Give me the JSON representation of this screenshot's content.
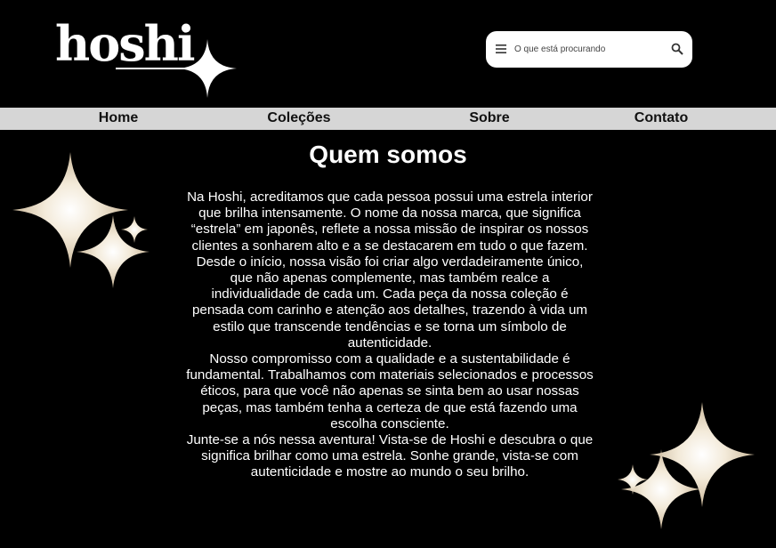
{
  "brand": {
    "name": "hoshi",
    "icon": "sparkle-star-icon"
  },
  "search": {
    "placeholder": "O que está procurando",
    "menu_icon": "menu-icon",
    "search_icon": "search-icon"
  },
  "nav": {
    "items": [
      {
        "label": "Home"
      },
      {
        "label": "Coleções"
      },
      {
        "label": "Sobre"
      },
      {
        "label": "Contato"
      }
    ]
  },
  "main": {
    "title": "Quem somos",
    "paragraphs": [
      "Na Hoshi, acreditamos que cada pessoa possui uma estrela interior que brilha intensamente. O nome da nossa marca, que significa “estrela” em japonês, reflete a nossa missão de inspirar os nossos clientes a sonharem alto e a se destacarem em tudo o que fazem.",
      "Desde o início, nossa visão foi criar algo verdadeiramente único, que não apenas complemente, mas também realce a individualidade de cada um. Cada peça da nossa coleção é pensada com carinho e atenção aos detalhes, trazendo à vida um estilo que transcende tendências e se torna um símbolo de autenticidade.",
      "Nosso compromisso com a qualidade e a sustentabilidade é fundamental. Trabalhamos com materiais selecionados e processos éticos, para que você não apenas se sinta bem ao usar nossas peças, mas também tenha a certeza de que está fazendo uma escolha consciente.",
      "Junte-se a nós nessa aventura! Vista-se de Hoshi e descubra o que significa brilhar como uma estrela. Sonhe grande, vista-se com autenticidade e mostre ao mundo o seu brilho."
    ]
  },
  "decorations": {
    "left_sparkles_icon": "sparkles-icon",
    "right_sparkles_icon": "sparkles-icon",
    "sparkle_color": "#f3ead9"
  }
}
